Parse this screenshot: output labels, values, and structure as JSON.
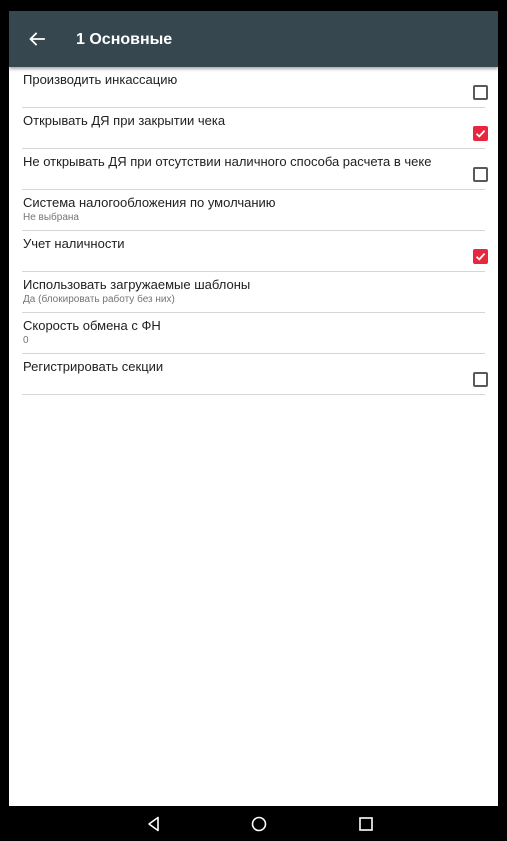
{
  "app_bar": {
    "title": "1 Основные",
    "back_icon": "arrow-back-icon",
    "background": "#37474f"
  },
  "preferences": [
    {
      "title": "Производить инкассацию",
      "summary": "",
      "control": "checkbox",
      "checked": false
    },
    {
      "title": "Открывать ДЯ при закрытии чека",
      "summary": "",
      "control": "checkbox",
      "checked": true
    },
    {
      "title": "Не открывать ДЯ при отсутствии наличного способа расчета в чеке",
      "summary": "",
      "control": "checkbox",
      "checked": false
    },
    {
      "title": "Система налогообложения по умолчанию",
      "summary": "Не выбрана",
      "control": "none"
    },
    {
      "title": "Учет наличности",
      "summary": "",
      "control": "checkbox",
      "checked": true
    },
    {
      "title": "Использовать загружаемые шаблоны",
      "summary": "Да (блокировать работу без них)",
      "control": "none"
    },
    {
      "title": "Скорость обмена с ФН",
      "summary": "0",
      "control": "none"
    },
    {
      "title": "Регистрировать секции",
      "summary": "",
      "control": "checkbox",
      "checked": false
    }
  ],
  "colors": {
    "checkbox_checked": "#e8263f",
    "checkbox_unchecked_border": "#595959"
  },
  "nav_bar": {
    "back_icon": "nav-back-triangle-icon",
    "home_icon": "nav-home-circle-icon",
    "recents_icon": "nav-recents-square-icon"
  }
}
